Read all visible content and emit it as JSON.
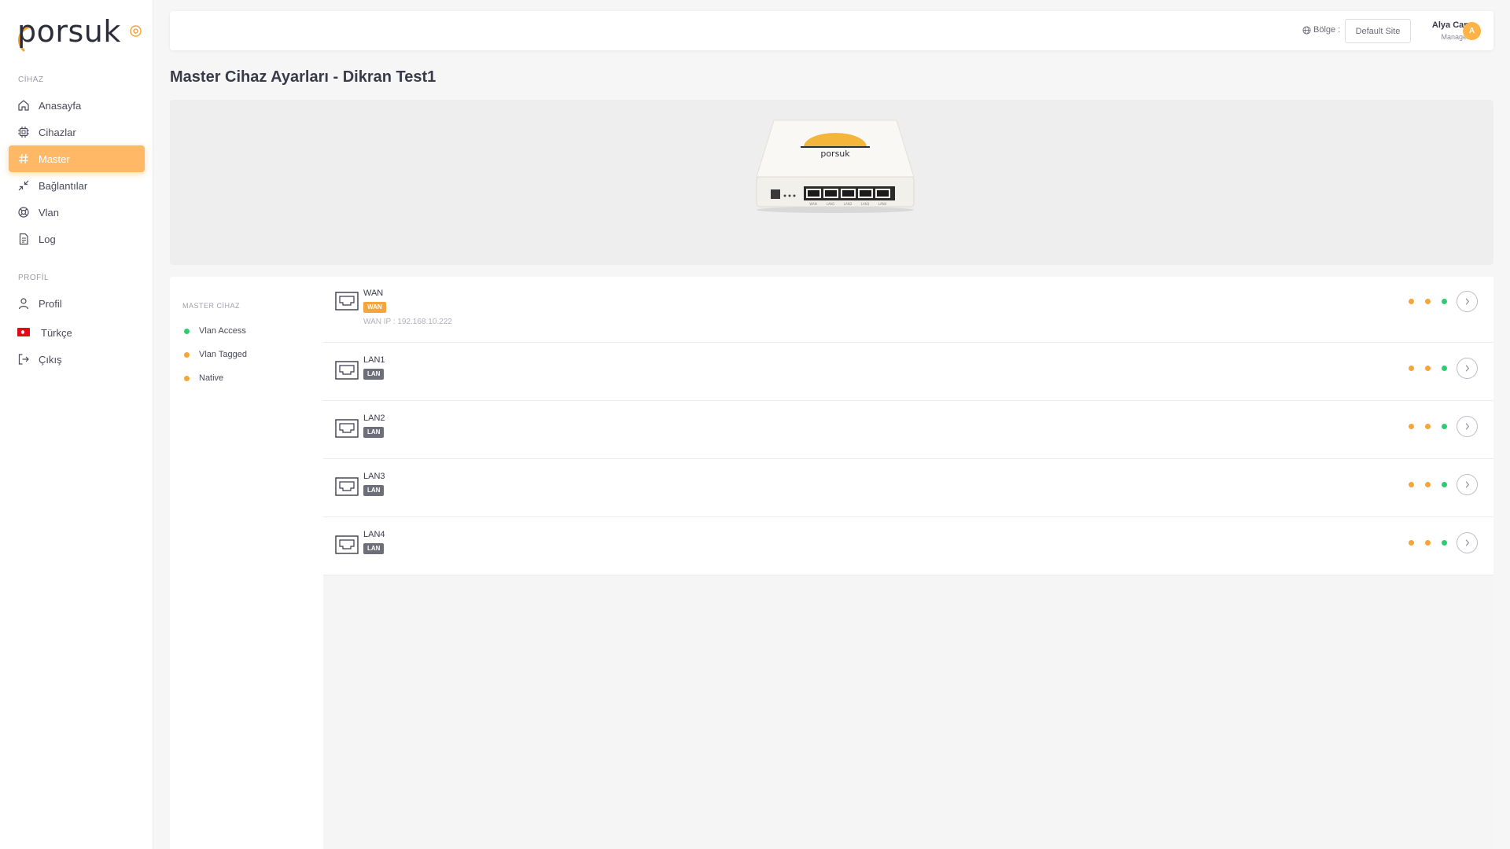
{
  "brand": {
    "name": "porsuk",
    "accent": "#ffb966",
    "status_green": "#2ecc71",
    "status_orange": "#f5a53a"
  },
  "sidebar": {
    "sections": [
      {
        "label": "CİHAZ"
      },
      {
        "label": "PROFİL"
      }
    ],
    "items": [
      {
        "label": "Anasayfa",
        "icon": "home-icon"
      },
      {
        "label": "Cihazlar",
        "icon": "chip-icon"
      },
      {
        "label": "Master",
        "icon": "hash-icon",
        "active": true
      },
      {
        "label": "Bağlantılar",
        "icon": "collapse-arrows-icon"
      },
      {
        "label": "Vlan",
        "icon": "lifebuoy-icon"
      },
      {
        "label": "Log",
        "icon": "document-icon"
      }
    ],
    "profile_items": [
      {
        "label": "Profil",
        "icon": "user-icon"
      },
      {
        "label": "Türkçe",
        "icon": "turkey-flag-icon"
      },
      {
        "label": "Çıkış",
        "icon": "logout-icon"
      }
    ]
  },
  "topbar": {
    "region_label": "Bölge :",
    "region_value": "Default Site",
    "user_name": "Alya Can",
    "user_role": "Manager",
    "avatar_initial": "A"
  },
  "page": {
    "title": "Master Cihaz Ayarları - Dikran Test1"
  },
  "legend": {
    "title": "MASTER CİHAZ",
    "items": [
      {
        "label": "Vlan Access",
        "color": "green"
      },
      {
        "label": "Vlan Tagged",
        "color": "orange"
      },
      {
        "label": "Native",
        "color": "orange"
      }
    ]
  },
  "ports": [
    {
      "name": "WAN",
      "badge": "WAN",
      "type": "wan",
      "ip": "WAN IP : 192.168.10.222",
      "status": [
        "orange",
        "orange",
        "green"
      ]
    },
    {
      "name": "LAN1",
      "badge": "LAN",
      "type": "lan",
      "status": [
        "orange",
        "orange",
        "green"
      ]
    },
    {
      "name": "LAN2",
      "badge": "LAN",
      "type": "lan",
      "status": [
        "orange",
        "orange",
        "green"
      ]
    },
    {
      "name": "LAN3",
      "badge": "LAN",
      "type": "lan",
      "status": [
        "orange",
        "orange",
        "green"
      ]
    },
    {
      "name": "LAN4",
      "badge": "LAN",
      "type": "lan",
      "status": [
        "orange",
        "orange",
        "green"
      ]
    }
  ],
  "device_image": {
    "logo_text": "porsuk",
    "port_labels": [
      "WAN",
      "LAN1",
      "LAN2",
      "LAN3",
      "LAN4"
    ]
  }
}
